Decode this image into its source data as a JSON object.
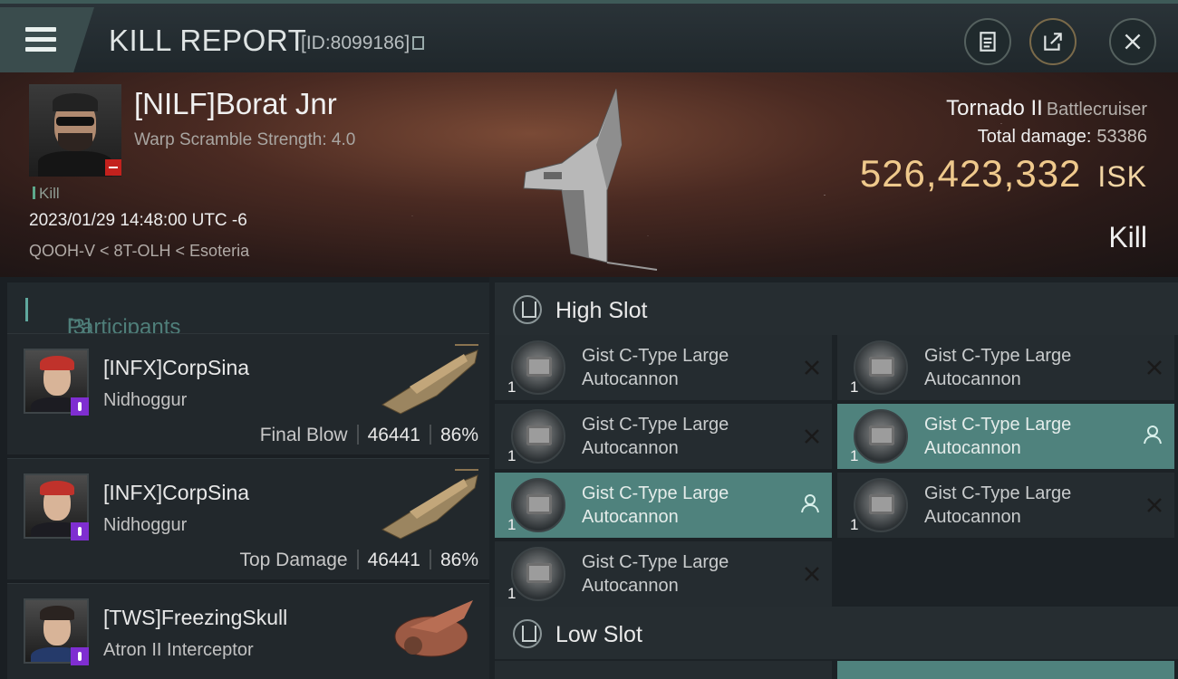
{
  "header": {
    "title": "KILL REPORT",
    "id": "[ID:8099186]"
  },
  "victim": {
    "name": "[NILF]Borat Jnr",
    "scramble": "Warp Scramble Strength: 4.0",
    "tag": "Kill",
    "datetime": "2023/01/29 14:48:00 UTC -6",
    "location": "QOOH-V < 8T-OLH < Esoteria",
    "ship": "Tornado II",
    "ship_class": "Battlecruiser",
    "total_damage_label": "Total damage:",
    "total_damage": "53386",
    "isk_value": "526,423,332",
    "isk_unit": "ISK",
    "result": "Kill"
  },
  "participants": {
    "label": "Participants",
    "count": "[3]",
    "items": [
      {
        "name": "[INFX]CorpSina",
        "ship": "Nidhoggur",
        "role": "Final Blow",
        "damage": "46441",
        "percent": "86%"
      },
      {
        "name": "[INFX]CorpSina",
        "ship": "Nidhoggur",
        "role": "Top Damage",
        "damage": "46441",
        "percent": "86%"
      },
      {
        "name": "[TWS]FreezingSkull",
        "ship": "Atron II Interceptor"
      }
    ]
  },
  "slots": {
    "high": {
      "label": "High Slot",
      "modules": [
        {
          "name": "Gist C-Type Large Autocannon",
          "qty": "1",
          "status": "destroyed"
        },
        {
          "name": "Gist C-Type Large Autocannon",
          "qty": "1",
          "status": "destroyed"
        },
        {
          "name": "Gist C-Type Large Autocannon",
          "qty": "1",
          "status": "destroyed"
        },
        {
          "name": "Gist C-Type Large Autocannon",
          "qty": "1",
          "status": "dropped"
        },
        {
          "name": "Gist C-Type Large Autocannon",
          "qty": "1",
          "status": "dropped"
        },
        {
          "name": "Gist C-Type Large Autocannon",
          "qty": "1",
          "status": "destroyed"
        },
        {
          "name": "Gist C-Type Large Autocannon",
          "qty": "1",
          "status": "destroyed"
        }
      ]
    },
    "low": {
      "label": "Low Slot"
    }
  },
  "colors": {
    "accent": "#4f827d",
    "isk": "#efc98c",
    "badge_red": "#c3211d",
    "badge_purple": "#7f2ed1"
  }
}
